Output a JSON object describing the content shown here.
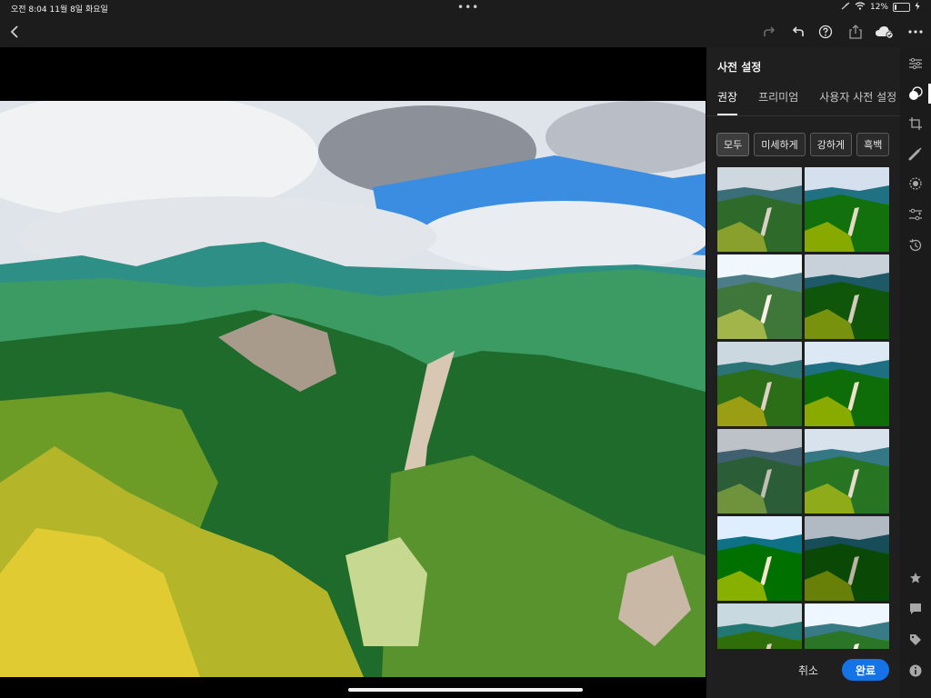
{
  "status_bar": {
    "time_date": "오전 8:04   11월 8일 화요일",
    "more_dots": "•••",
    "battery": "12%",
    "battery_level": 0.12
  },
  "toolbar": {
    "back": "back-icon",
    "redo": "redo-icon",
    "undo": "undo-icon",
    "help": "help-icon",
    "share": "share-icon",
    "cloud": "cloud-sync-icon",
    "more": "more-icon"
  },
  "panel": {
    "title": "사전 설정",
    "tabs": [
      {
        "label": "권장",
        "active": true
      },
      {
        "label": "프리미엄",
        "active": false
      },
      {
        "label": "사용자 사전 설정",
        "active": false
      }
    ],
    "chips": [
      {
        "label": "모두",
        "active": true
      },
      {
        "label": "미세하게",
        "active": false
      },
      {
        "label": "강하게",
        "active": false
      },
      {
        "label": "흑백",
        "active": false
      }
    ],
    "preset_count": 12,
    "cancel_label": "취소",
    "done_label": "완료"
  },
  "rail": {
    "icons": [
      "edit-sliders-icon",
      "presets-icon",
      "crop-icon",
      "healing-icon",
      "masking-icon",
      "versions-icon",
      "history-icon",
      "star-icon",
      "comment-icon",
      "tag-icon",
      "info-icon"
    ]
  },
  "colors": {
    "accent": "#1473e6",
    "panel_bg": "#1f1f1f",
    "toolbar_bg": "#1c1c1c"
  }
}
